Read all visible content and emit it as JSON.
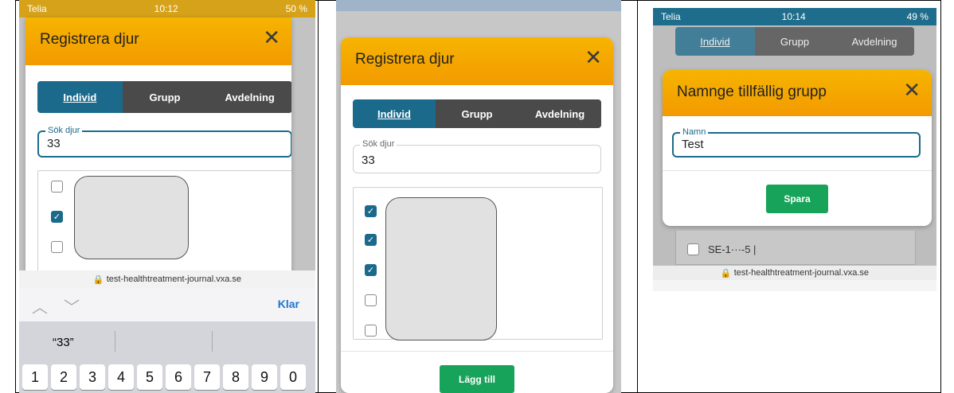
{
  "screen1": {
    "status": {
      "carrier": "Telia",
      "time": "10:12",
      "battery": "50 %"
    },
    "modal_title": "Registrera djur",
    "tabs": [
      "Individ",
      "Grupp",
      "Avdelning"
    ],
    "search": {
      "label": "Sök djur",
      "value": "33"
    },
    "url": "test-healthtreatment-journal.vxa.se",
    "keyboard": {
      "done": "Klar",
      "suggestion": "“33”",
      "keys": [
        "1",
        "2",
        "3",
        "4",
        "5",
        "6",
        "7",
        "8",
        "9",
        "0"
      ]
    }
  },
  "screen2": {
    "modal_title": "Registrera djur",
    "tabs": [
      "Individ",
      "Grupp",
      "Avdelning"
    ],
    "search": {
      "label": "Sök djur",
      "value": "33"
    },
    "add_button": "Lägg till"
  },
  "screen3": {
    "status": {
      "carrier": "Telia",
      "time": "10:14",
      "battery": "49 %"
    },
    "tabs": [
      "Individ",
      "Grupp",
      "Avdelning"
    ],
    "modal_title": "Namnge tillfällig grupp",
    "name_field": {
      "label": "Namn",
      "value": "Test"
    },
    "save_button": "Spara",
    "list_item": "SE-1···-5 |",
    "url": "test-healthtreatment-journal.vxa.se"
  },
  "colors": {
    "accent": "#1b6a8c",
    "header": "#f6a800",
    "button": "#18a35a"
  }
}
